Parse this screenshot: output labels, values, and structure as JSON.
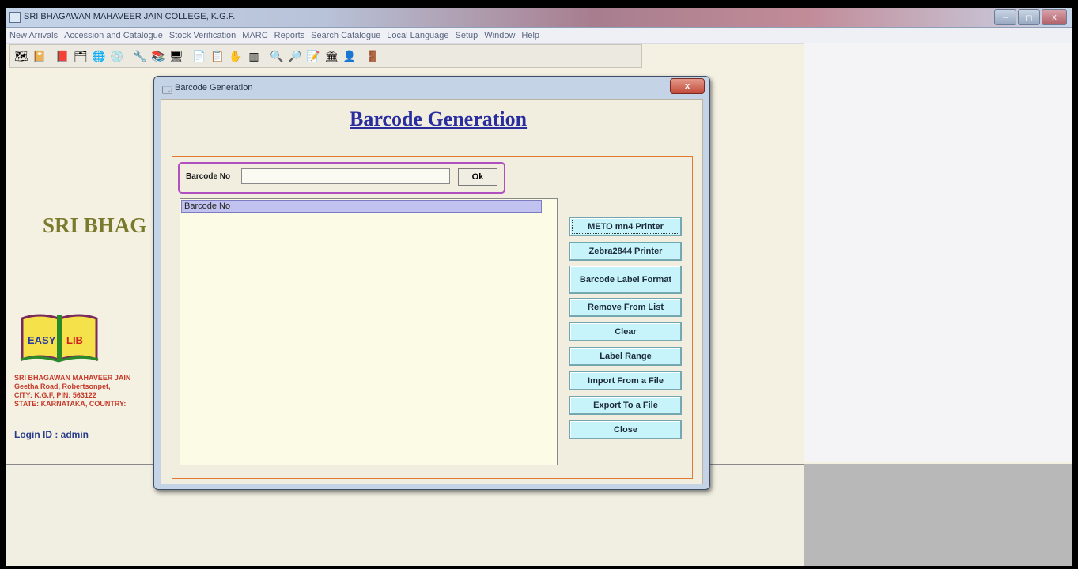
{
  "window": {
    "title": "SRI BHAGAWAN MAHAVEER JAIN COLLEGE, K.G.F.",
    "controls": [
      "–",
      "◻",
      "x"
    ]
  },
  "menubar": [
    "New Arrivals",
    "Accession and Catalogue",
    "Stock Verification",
    "MARC",
    "Reports",
    "Search Catalogue",
    "Local Language",
    "Setup",
    "Window",
    "Help"
  ],
  "toolbar_icons": [
    "new-arrivals-icon",
    "catalogue-icon",
    "book-icon",
    "card-icon",
    "globe-icon",
    "cd-icon",
    "tools-icon",
    "books-icon",
    "monitor-icon",
    "page-icon",
    "list-icon",
    "hand-icon",
    "barcode-icon",
    "search-icon",
    "search-cards-icon",
    "edit-icon",
    "library-icon",
    "user-search-icon",
    "exit-icon"
  ],
  "background": {
    "banner_text": "SRI BHAG",
    "logo_left": "EASY",
    "logo_right": "LIB",
    "address_lines": [
      "SRI BHAGAWAN MAHAVEER JAIN",
      "Geetha Road, Robertsonpet,",
      "CITY: K.G.F, PIN: 563122",
      "STATE: KARNATAKA, COUNTRY:"
    ],
    "login": "Login ID : admin"
  },
  "dialog": {
    "title": "Barcode Generation",
    "close": "x",
    "heading": "Barcode Generation",
    "search": {
      "label": "Barcode No",
      "value": "",
      "ok_label": "Ok"
    },
    "list_header": "Barcode No",
    "buttons": {
      "meto": "METO mn4 Printer",
      "zebra": "Zebra2844 Printer",
      "label_format": "Barcode Label Format",
      "remove": "Remove From List",
      "clear": "Clear",
      "label_range": "Label Range",
      "import": "Import From a File",
      "export": "Export To a File",
      "close": "Close"
    }
  }
}
